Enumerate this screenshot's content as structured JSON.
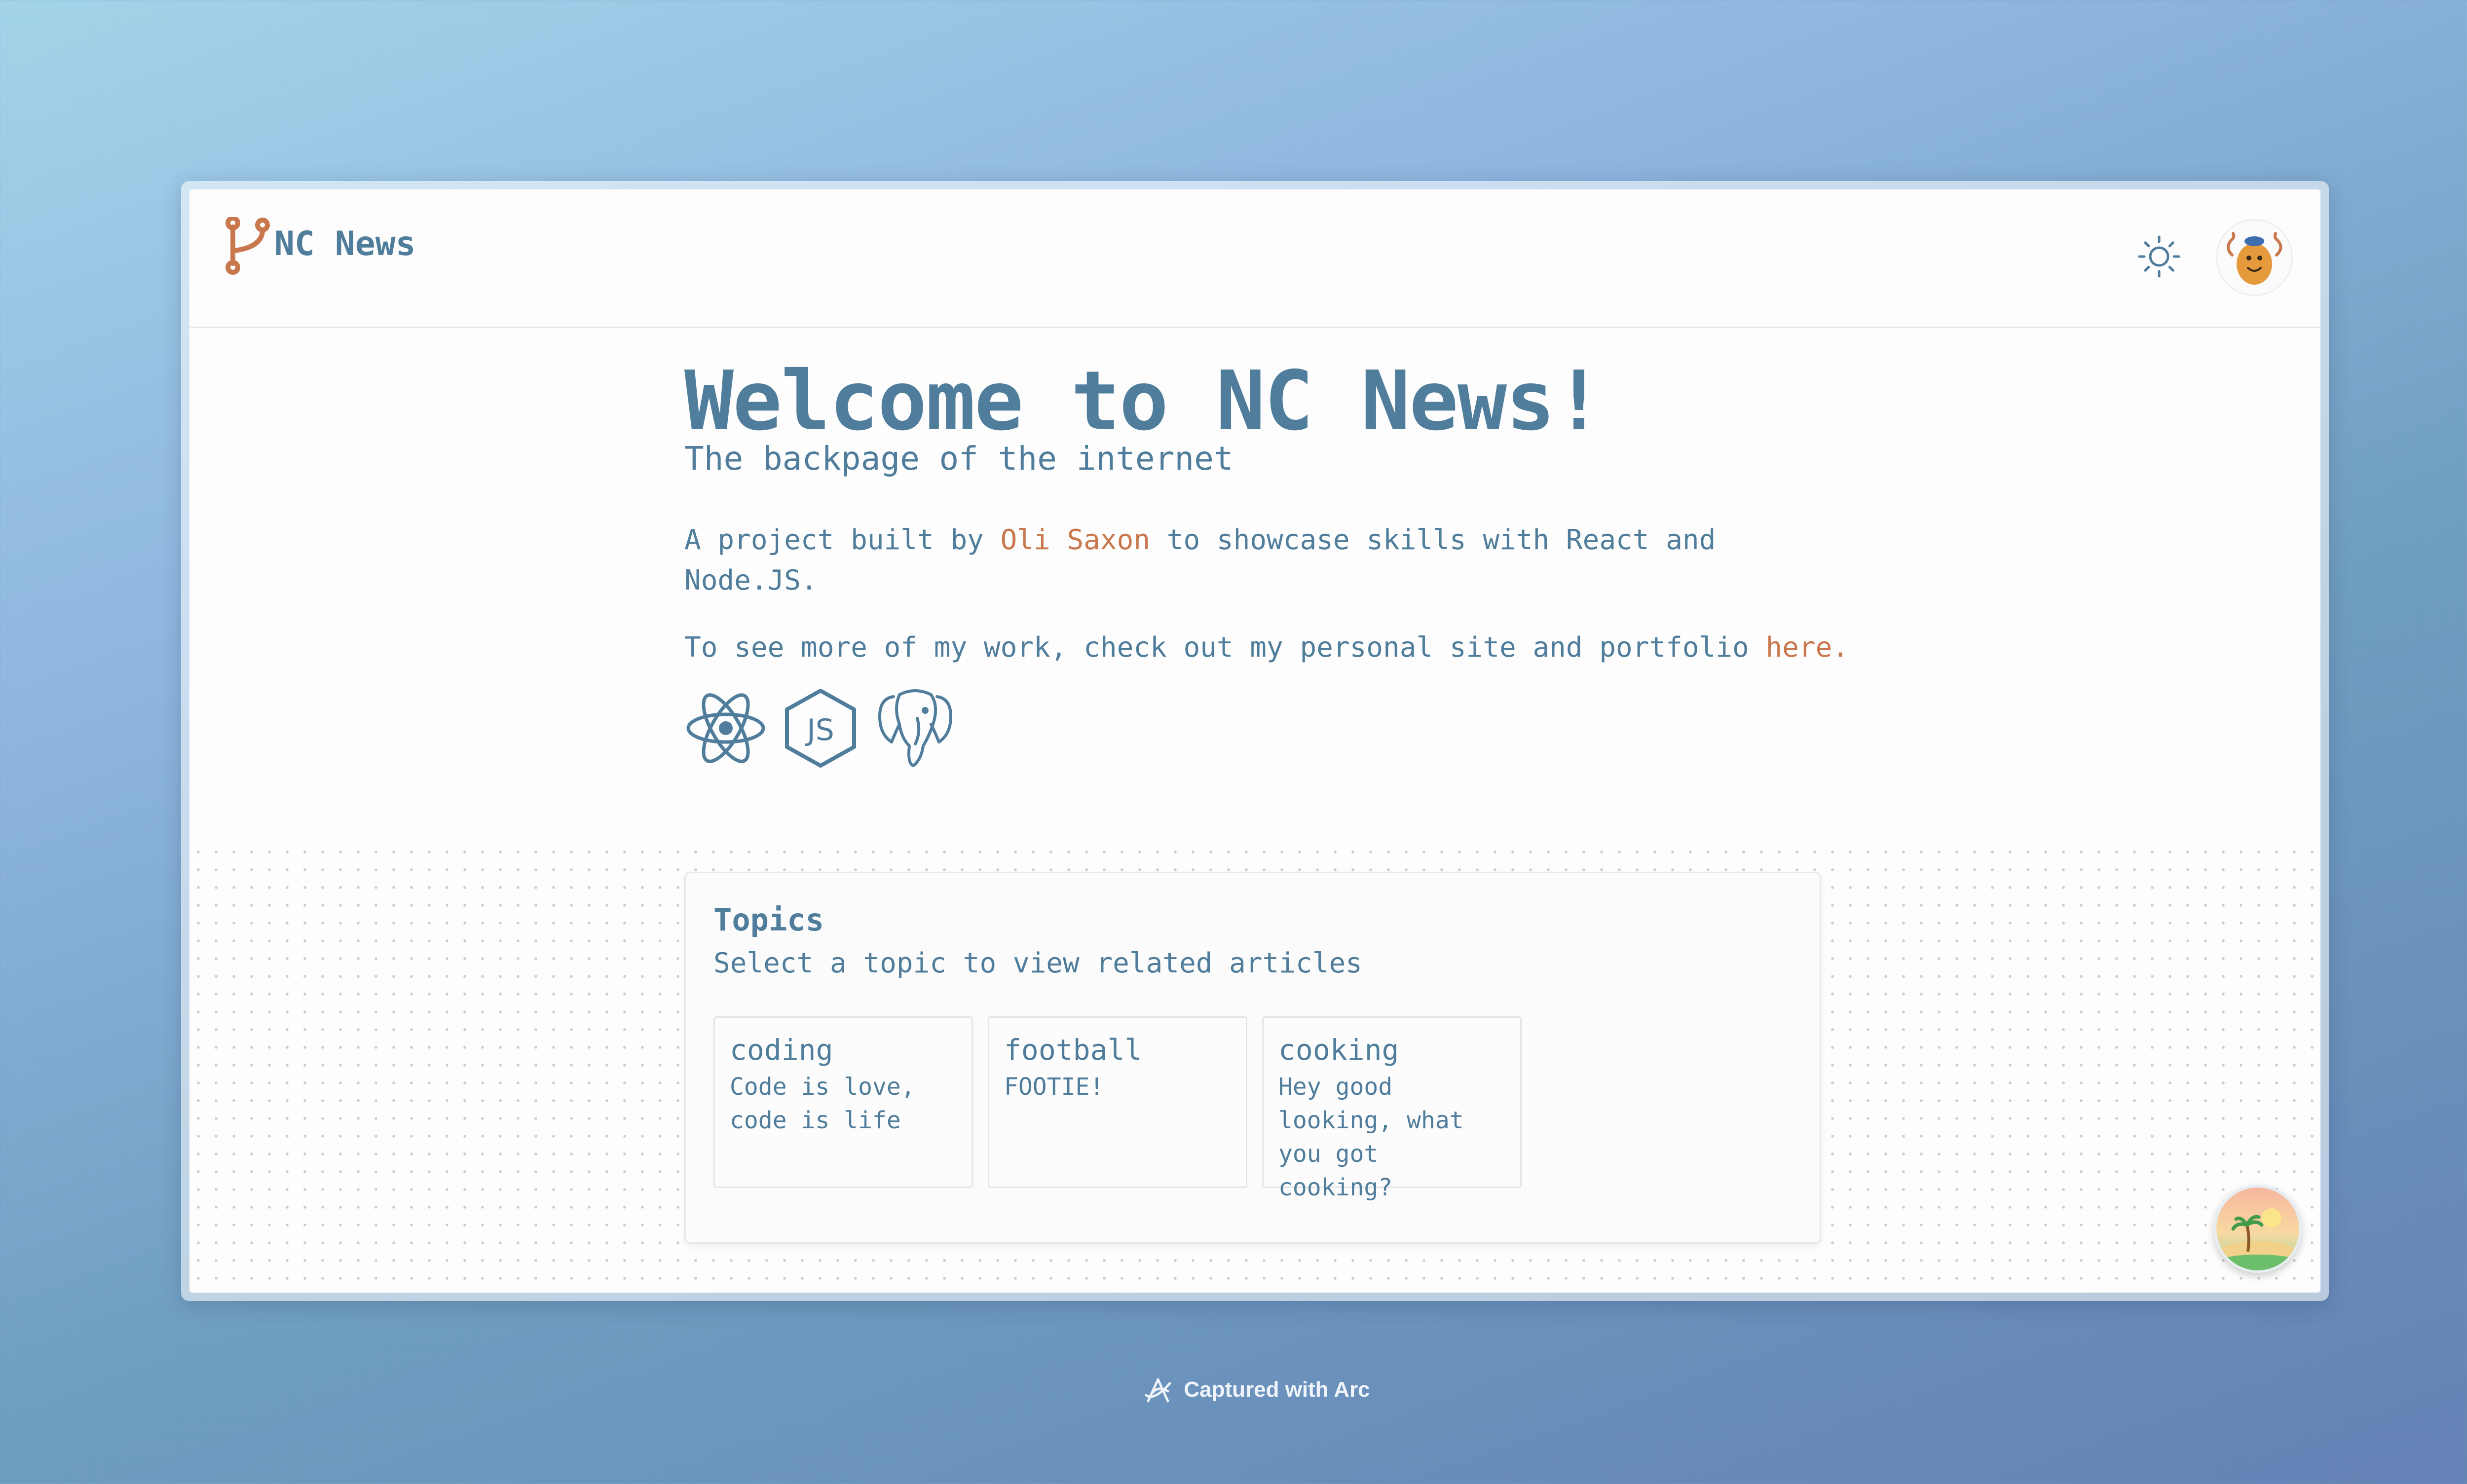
{
  "app": {
    "name": "NC News"
  },
  "hero": {
    "title": "Welcome to NC News!",
    "subtitle": "The backpage of the internet",
    "intro_prefix": "A project built by ",
    "author": "Oli Saxon",
    "intro_suffix": " to showcase skills with React and Node.JS.",
    "portfolio_prefix": "To see more of my work, check out my personal site and portfolio ",
    "portfolio_link": "here."
  },
  "tech_icons": [
    "react-icon",
    "nodejs-icon",
    "postgresql-icon"
  ],
  "topics": {
    "heading": "Topics",
    "subheading": "Select a topic to view related articles",
    "items": [
      {
        "slug": "coding",
        "description": "Code is love, code is life"
      },
      {
        "slug": "football",
        "description": "FOOTIE!"
      },
      {
        "slug": "cooking",
        "description": "Hey good looking, what you got cooking?"
      }
    ]
  },
  "footer": {
    "capture_label": "Captured with Arc"
  },
  "colors": {
    "primary": "#4f7d9b",
    "accent": "#c9784e",
    "background": "#fdfdfd"
  }
}
